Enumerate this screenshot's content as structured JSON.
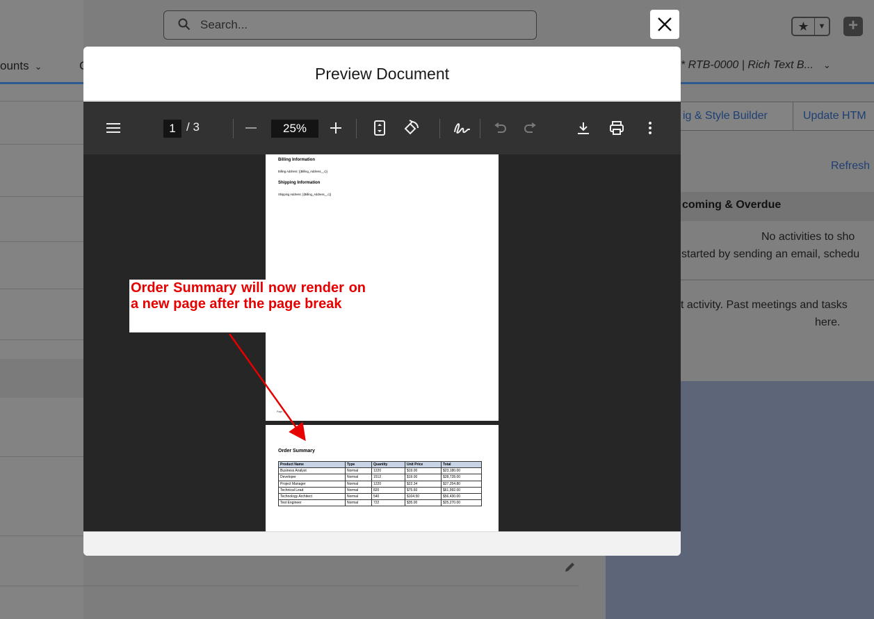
{
  "background": {
    "tab_accounts": "ounts",
    "tab_c": "C",
    "search_placeholder": "Search...",
    "active_tab": "* RTB-0000 | Rich Text B...",
    "action_buttons": [
      "ig & Style Builder",
      "Update HTM"
    ],
    "refresh": "Refresh",
    "upcoming_overdue": "coming & Overdue",
    "no_activities": "No activities to sho",
    "get_started": "started by sending an email, schedu",
    "past_activity": "t activity. Past meetings and tasks",
    "past_activity_2": "here."
  },
  "modal": {
    "title": "Preview Document"
  },
  "pdf_viewer": {
    "current_page": "1",
    "total_pages": "/ 3",
    "zoom": "25%",
    "icons": [
      "menu-icon",
      "zoom-out-icon",
      "zoom-in-icon",
      "fit-page-icon",
      "rotate-icon",
      "draw-icon",
      "undo-icon",
      "redo-icon",
      "download-icon",
      "print-icon",
      "more-options-icon"
    ]
  },
  "document": {
    "page1": {
      "billing_heading": "Billing Information",
      "billing_address": "Billing Address: {{Billing_Address__c}}",
      "shipping_heading": "Shipping Information",
      "shipping_address": "Shipping Address: {{Billing_Address__c}}",
      "footer": "Page 1"
    },
    "page2": {
      "heading": "Order Summary",
      "columns": [
        "Product Name",
        "Type",
        "Quantity",
        "Unit Price",
        "Total"
      ],
      "rows": [
        [
          "Business Analyst",
          "Normal",
          "1220",
          "$19.00",
          "$23,180.00"
        ],
        [
          "Developer",
          "Normal",
          "1512",
          "$19.00",
          "$28,728.00"
        ],
        [
          "Project Manager",
          "Normal",
          "1220",
          "$22.34",
          "$27,254.80"
        ],
        [
          "Technical Lead",
          "Normal",
          "820",
          "$75.60",
          "$61,992.00"
        ],
        [
          "Technology Architect",
          "Normal",
          "540",
          "$104.50",
          "$56,430.00"
        ],
        [
          "Test Engineer",
          "Normal",
          "722",
          "$35.00",
          "$25,270.00"
        ]
      ]
    }
  },
  "annotation": {
    "text": "Order Summary will now render on a new page after the page break",
    "color": "#e60000"
  }
}
